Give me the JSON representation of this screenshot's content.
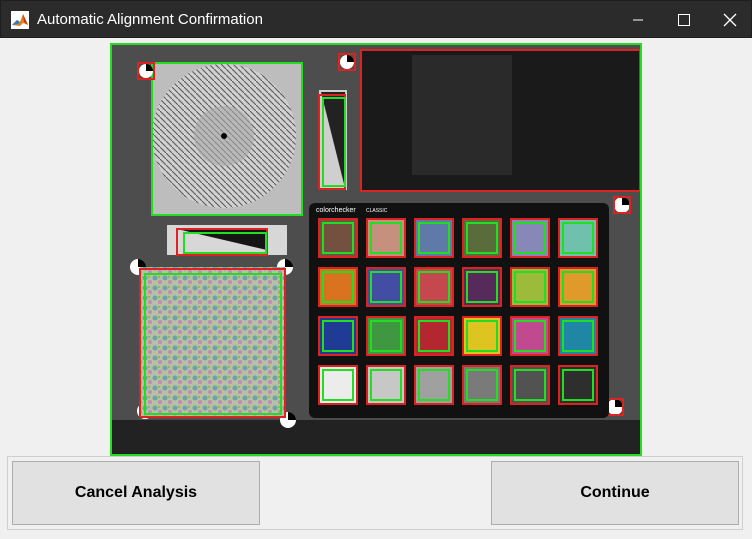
{
  "window": {
    "title": "Automatic Alignment Confirmation",
    "icon": "matlab-icon",
    "controls": [
      "minimize-icon",
      "maximize-icon",
      "close-icon"
    ]
  },
  "image": {
    "description_label": "",
    "chart_brand": "colorchecker",
    "chart_subtitle": "CLASSIC",
    "detection_colors": {
      "detected": "#22dd22",
      "reference": "#dd2222"
    }
  },
  "buttons": {
    "cancel_label": "Cancel Analysis",
    "continue_label": "Continue"
  },
  "colors": {
    "titlebar": "#2b2b2b",
    "panel": "#f0f0f0",
    "button": "#e1e1e1"
  }
}
